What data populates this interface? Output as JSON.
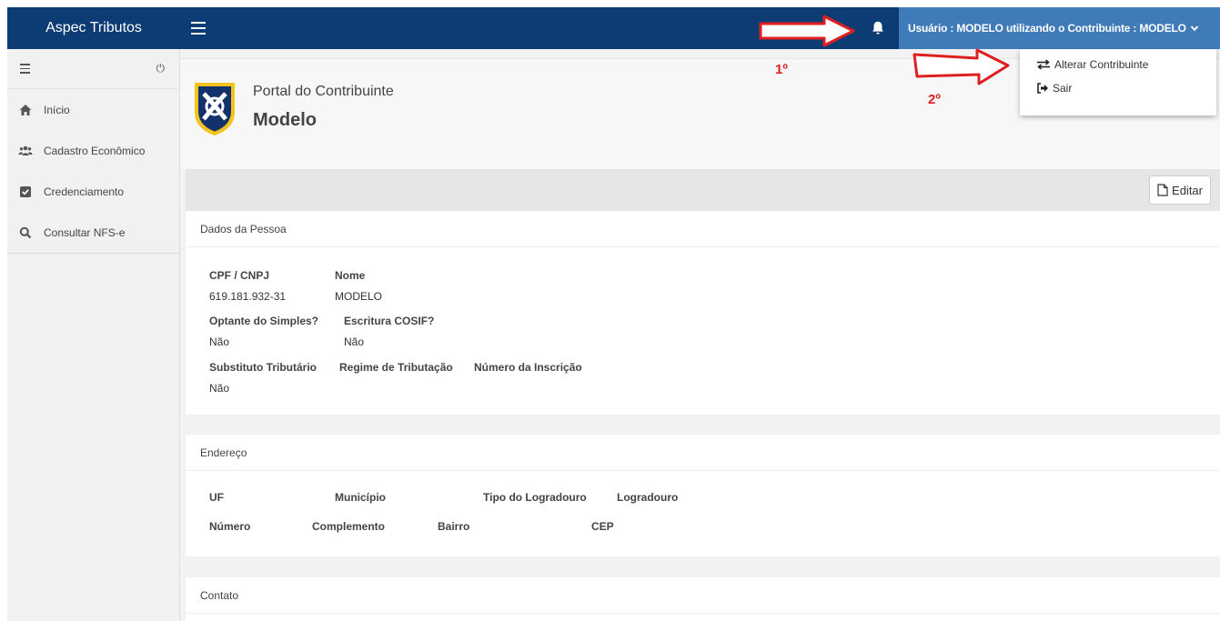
{
  "topbar": {
    "brand": "Aspec Tributos",
    "user_label": "Usuário : MODELO utilizando o Contribuinte : MODELO"
  },
  "dropdown": {
    "items": [
      {
        "label": "Alterar Contribuinte",
        "icon": "exchange-icon"
      },
      {
        "label": "Sair",
        "icon": "sign-out-icon"
      }
    ]
  },
  "sidebar": {
    "items": [
      {
        "label": "Início",
        "icon": "home-icon"
      },
      {
        "label": "Cadastro Econômico",
        "icon": "users-icon"
      },
      {
        "label": "Credenciamento",
        "icon": "check-square-icon"
      },
      {
        "label": "Consultar NFS-e",
        "icon": "search-icon"
      }
    ]
  },
  "header": {
    "title": "Portal do Contribuinte",
    "name": "Modelo"
  },
  "toolbar": {
    "edit_label": "Editar"
  },
  "pessoa": {
    "title": "Dados da Pessoa",
    "cpf_label": "CPF / CNPJ",
    "cpf_value": "619.181.932-31",
    "nome_label": "Nome",
    "nome_value": "MODELO",
    "simples_label": "Optante do Simples?",
    "simples_value": "Não",
    "cosif_label": "Escritura COSIF?",
    "cosif_value": "Não",
    "substituto_label": "Substituto Tributário",
    "substituto_value": "Não",
    "regime_label": "Regime de Tributação",
    "inscricao_label": "Número da Inscrição"
  },
  "endereco": {
    "title": "Endereço",
    "uf_label": "UF",
    "municipio_label": "Município",
    "tipo_label": "Tipo do Logradouro",
    "logradouro_label": "Logradouro",
    "numero_label": "Número",
    "complemento_label": "Complemento",
    "bairro_label": "Bairro",
    "cep_label": "CEP"
  },
  "contato": {
    "title": "Contato"
  },
  "annotations": {
    "first": "1º",
    "second": "2º"
  },
  "colors": {
    "topbar": "#0d3b73",
    "user_menu": "#3f7ab9",
    "annotation": "#e02020"
  }
}
